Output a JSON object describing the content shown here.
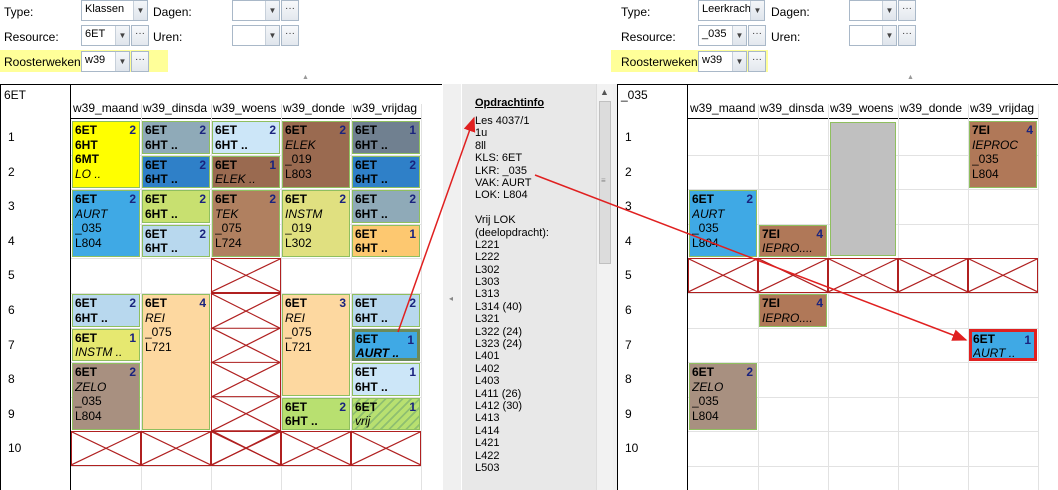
{
  "left": {
    "type_label": "Type:",
    "type_value": "Klassen",
    "dagen_label": "Dagen:",
    "resource_label": "Resource:",
    "resource_value": "6ET",
    "uren_label": "Uren:",
    "weeks_label": "Roosterweken:",
    "weeks_value": "w39",
    "resource_title": "6ET",
    "days": [
      "w39_maand",
      "w39_dinsda",
      "w39_woens",
      "w39_donde",
      "w39_vrijdag"
    ]
  },
  "right": {
    "type_label": "Type:",
    "type_value": "Leerkracht",
    "dagen_label": "Dagen:",
    "resource_label": "Resource:",
    "resource_value": "_035",
    "uren_label": "Uren:",
    "weeks_label": "Roosterweken:",
    "weeks_value": "w39",
    "resource_title": "_035",
    "days": [
      "w39_maand",
      "w39_dinsda",
      "w39_woens",
      "w39_donde",
      "w39_vrijdag"
    ]
  },
  "hours": [
    "1",
    "2",
    "3",
    "4",
    "5",
    "6",
    "7",
    "8",
    "9",
    "10"
  ],
  "ellipsis": "···",
  "info": {
    "title": "Opdrachtinfo",
    "lines": [
      "Les 4037/1",
      "1u",
      "8ll",
      "KLS:  6ET",
      "LKR: _035",
      "VAK: AURT",
      "LOK: L804",
      "",
      "Vrij LOK",
      "(deelopdracht):",
      "L221",
      "L222",
      "L302",
      "L303",
      "L313",
      "L314 (40)",
      "L321",
      "L322 (24)",
      "L323 (24)",
      "L401",
      "L402",
      "L403",
      "L411 (26)",
      "L412 (30)",
      "L413",
      "L414",
      "L421",
      "L422",
      "L503"
    ]
  },
  "lessons_left": [
    {
      "id": "m1",
      "bg": "#ffff00",
      "num": "2",
      "lines": [
        {
          "t": "6ET",
          "s": "b"
        },
        {
          "t": "6HT",
          "s": "b"
        },
        {
          "t": "6MT",
          "s": "b"
        },
        {
          "t": "LO ..",
          "s": "i"
        }
      ]
    },
    {
      "id": "m3",
      "bg": "#3fa9e5",
      "num": "2",
      "lines": [
        {
          "t": "6ET",
          "s": "b"
        },
        {
          "t": "AURT",
          "s": "i"
        },
        {
          "t": "_035",
          "s": ""
        },
        {
          "t": "L804",
          "s": ""
        }
      ]
    },
    {
      "id": "m6",
      "bg": "#b8d8ee",
      "num": "2",
      "lines": [
        {
          "t": "6ET",
          "s": "b"
        },
        {
          "t": "6HT ..",
          "s": "b"
        }
      ]
    },
    {
      "id": "m7",
      "bg": "#e6e870",
      "num": "1",
      "lines": [
        {
          "t": "6ET",
          "s": "b"
        },
        {
          "t": "INSTM ..",
          "s": "i"
        }
      ]
    },
    {
      "id": "m8",
      "bg": "#a89080",
      "num": "2",
      "lines": [
        {
          "t": "6ET",
          "s": "b"
        },
        {
          "t": "ZELO",
          "s": "i"
        },
        {
          "t": "_035",
          "s": ""
        },
        {
          "t": "L804",
          "s": ""
        }
      ]
    },
    {
      "id": "d1",
      "bg": "#8faab8",
      "num": "2",
      "lines": [
        {
          "t": "6ET",
          "s": "b"
        },
        {
          "t": "6HT ..",
          "s": "b"
        }
      ]
    },
    {
      "id": "d2",
      "bg": "#2f80c8",
      "num": "2",
      "lines": [
        {
          "t": "6ET",
          "s": "b"
        },
        {
          "t": "6HT ..",
          "s": "b"
        }
      ]
    },
    {
      "id": "d3",
      "bg": "#c8e070",
      "num": "2",
      "lines": [
        {
          "t": "6ET",
          "s": "b"
        },
        {
          "t": "6HT ..",
          "s": "b"
        }
      ]
    },
    {
      "id": "d4",
      "bg": "#b8d8ee",
      "num": "2",
      "lines": [
        {
          "t": "6ET",
          "s": "b"
        },
        {
          "t": "6HT ..",
          "s": "b"
        }
      ]
    },
    {
      "id": "d6",
      "bg": "#fdd8a0",
      "num": "4",
      "lines": [
        {
          "t": "6ET",
          "s": "b"
        },
        {
          "t": "REI",
          "s": "i"
        },
        {
          "t": "_075",
          "s": ""
        },
        {
          "t": "L721",
          "s": ""
        }
      ]
    },
    {
      "id": "w1",
      "bg": "#cce6f8",
      "num": "2",
      "lines": [
        {
          "t": "6ET",
          "s": "b"
        },
        {
          "t": "6HT ..",
          "s": "b"
        }
      ]
    },
    {
      "id": "w2",
      "bg": "#9a6a50",
      "num": "1",
      "lines": [
        {
          "t": "6ET",
          "s": "b"
        },
        {
          "t": "ELEK ..",
          "s": "i"
        }
      ]
    },
    {
      "id": "w3",
      "bg": "#b08060",
      "num": "2",
      "lines": [
        {
          "t": "6ET",
          "s": "b"
        },
        {
          "t": "TEK",
          "s": "i"
        },
        {
          "t": "_075",
          "s": ""
        },
        {
          "t": "L724",
          "s": ""
        }
      ]
    },
    {
      "id": "o1",
      "bg": "#9a6a50",
      "num": "2",
      "lines": [
        {
          "t": "6ET",
          "s": "b"
        },
        {
          "t": "ELEK",
          "s": "i"
        },
        {
          "t": "_019",
          "s": ""
        },
        {
          "t": "L803",
          "s": ""
        }
      ]
    },
    {
      "id": "o3",
      "bg": "#e0e080",
      "num": "2",
      "lines": [
        {
          "t": "6ET",
          "s": "b"
        },
        {
          "t": "INSTM",
          "s": "i"
        },
        {
          "t": "_019",
          "s": ""
        },
        {
          "t": "L302",
          "s": ""
        }
      ]
    },
    {
      "id": "o6",
      "bg": "#fdd8a0",
      "num": "3",
      "lines": [
        {
          "t": "6ET",
          "s": "b"
        },
        {
          "t": "REI",
          "s": "i"
        },
        {
          "t": "_075",
          "s": ""
        },
        {
          "t": "L721",
          "s": ""
        }
      ]
    },
    {
      "id": "o9",
      "bg": "#b8e070",
      "num": "2",
      "lines": [
        {
          "t": "6ET",
          "s": "b"
        },
        {
          "t": "6HT ..",
          "s": "b"
        }
      ]
    },
    {
      "id": "v1",
      "bg": "#708090",
      "num": "1",
      "lines": [
        {
          "t": "6ET",
          "s": "b"
        },
        {
          "t": "6HT ..",
          "s": "b"
        }
      ]
    },
    {
      "id": "v2",
      "bg": "#2f80c8",
      "num": "2",
      "lines": [
        {
          "t": "6ET",
          "s": "b"
        },
        {
          "t": "6HT ..",
          "s": "b"
        }
      ]
    },
    {
      "id": "v3",
      "bg": "#8faab8",
      "num": "2",
      "lines": [
        {
          "t": "6ET",
          "s": "b"
        },
        {
          "t": "6HT ..",
          "s": "b"
        }
      ]
    },
    {
      "id": "v4",
      "bg": "#fdc870",
      "num": "1",
      "lines": [
        {
          "t": "6ET",
          "s": "b"
        },
        {
          "t": "6HT ..",
          "s": "b"
        }
      ]
    },
    {
      "id": "v6",
      "bg": "#b8d8ee",
      "num": "2",
      "lines": [
        {
          "t": "6ET",
          "s": "b"
        },
        {
          "t": "6HT ..",
          "s": "b"
        }
      ]
    },
    {
      "id": "v7",
      "bg": "#3fa9e5",
      "num": "1",
      "lines": [
        {
          "t": "6ET",
          "s": "b"
        },
        {
          "t": "AURT ..",
          "s": "bi"
        }
      ]
    },
    {
      "id": "v8",
      "bg": "#cce6f8",
      "num": "1",
      "lines": [
        {
          "t": "6ET",
          "s": "b"
        },
        {
          "t": "6HT ..",
          "s": "b"
        }
      ]
    },
    {
      "id": "v9",
      "bg": "#b8e070",
      "num": "1",
      "lines": [
        {
          "t": "6ET",
          "s": "b"
        },
        {
          "t": "vrij",
          "s": "i"
        }
      ]
    }
  ],
  "lessons_right": [
    {
      "id": "rm3",
      "bg": "#3fa9e5",
      "num": "2",
      "lines": [
        {
          "t": "6ET",
          "s": "b"
        },
        {
          "t": "AURT",
          "s": "i"
        },
        {
          "t": "_035",
          "s": ""
        },
        {
          "t": "L804",
          "s": ""
        }
      ]
    },
    {
      "id": "rm8",
      "bg": "#a89080",
      "num": "2",
      "lines": [
        {
          "t": "6ET",
          "s": "b"
        },
        {
          "t": "ZELO",
          "s": "i"
        },
        {
          "t": "_035",
          "s": ""
        },
        {
          "t": "L804",
          "s": ""
        }
      ]
    },
    {
      "id": "rd4",
      "bg": "#b07858",
      "num": "4",
      "lines": [
        {
          "t": "7EI",
          "s": "b"
        },
        {
          "t": "IEPRO....",
          "s": "i"
        }
      ]
    },
    {
      "id": "rd6",
      "bg": "#b07858",
      "num": "4",
      "lines": [
        {
          "t": "7EI",
          "s": "b"
        },
        {
          "t": "IEPRO....",
          "s": "i"
        }
      ]
    },
    {
      "id": "rv1",
      "bg": "#b07858",
      "num": "4",
      "lines": [
        {
          "t": "7EI",
          "s": "b"
        },
        {
          "t": "IEPROC",
          "s": "i"
        },
        {
          "t": "_035",
          "s": ""
        },
        {
          "t": "L804",
          "s": ""
        }
      ]
    },
    {
      "id": "rv7",
      "bg": "#3fa9e5",
      "num": "1",
      "lines": [
        {
          "t": "6ET",
          "s": "b"
        },
        {
          "t": "AURT ..",
          "s": "i"
        }
      ]
    }
  ],
  "colors": {
    "highlight": "#ffff99",
    "arrow": "#e02020",
    "cross": "#b02020",
    "selected_border": "#e02020"
  }
}
